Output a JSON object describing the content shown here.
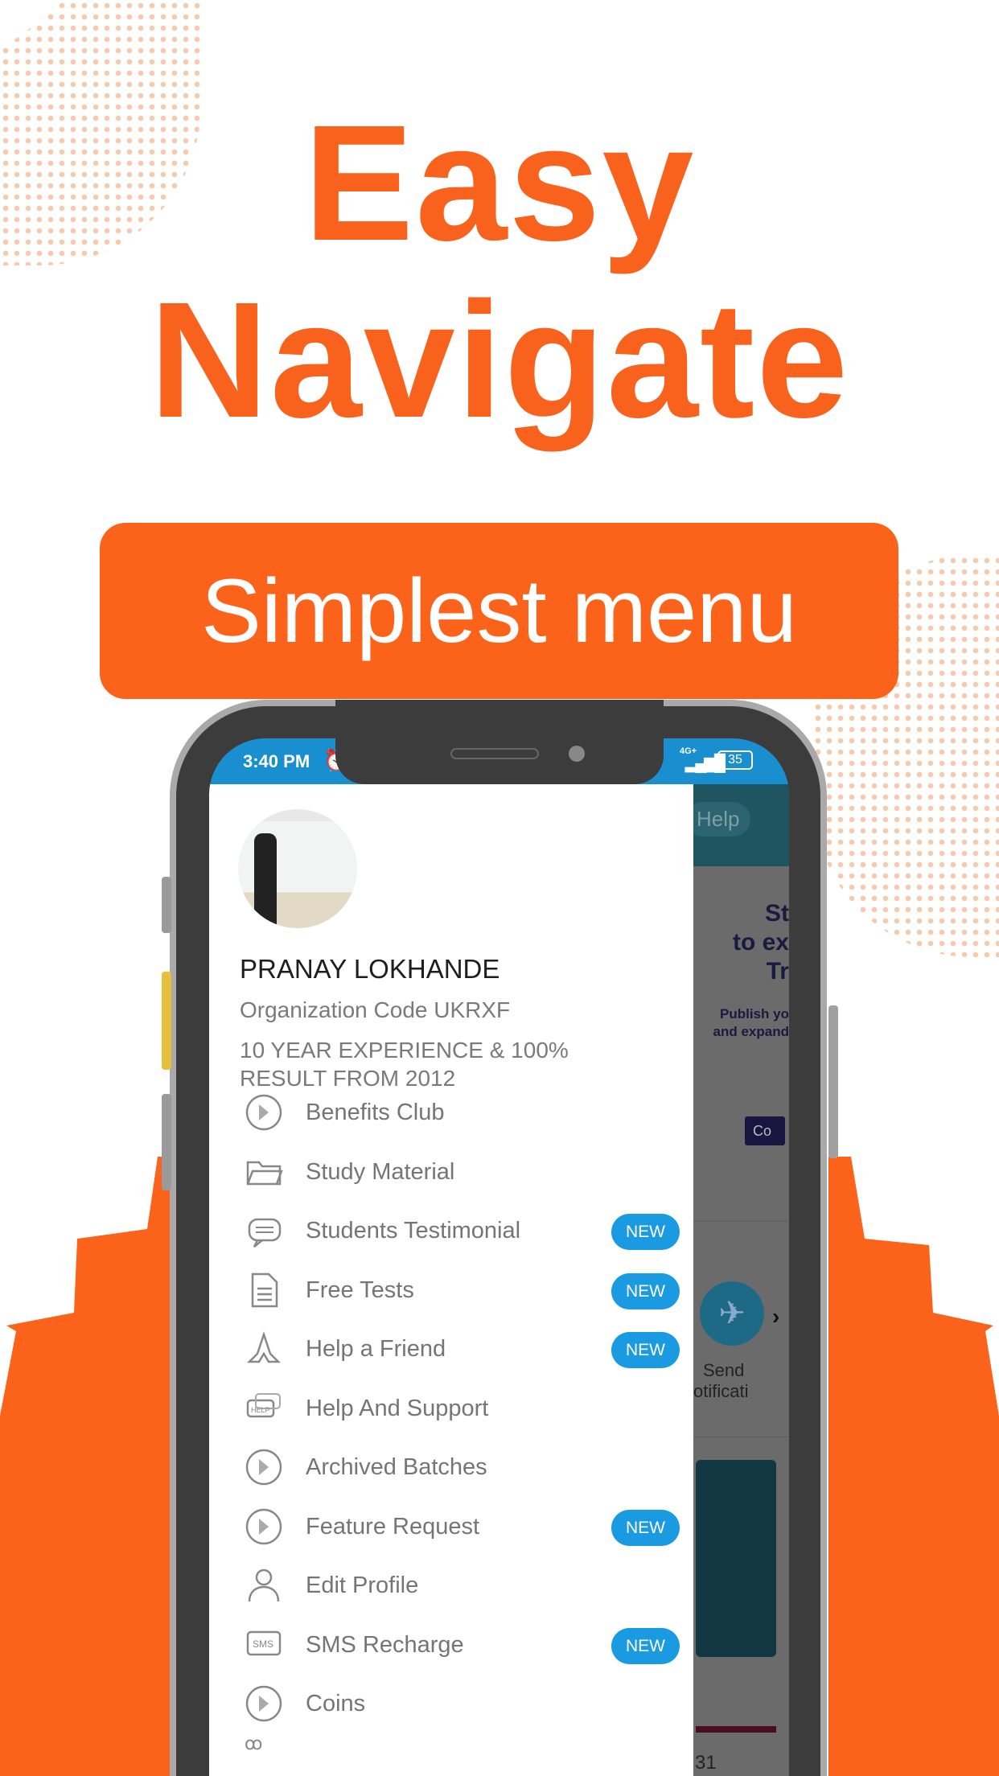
{
  "headline": {
    "line1": "Easy",
    "line2": "Navigate"
  },
  "banner": "Simplest menu",
  "colors": {
    "brand_orange": "#f9621d",
    "status_blue": "#1a8fd0",
    "badge_blue": "#1a9ae0"
  },
  "status_bar": {
    "time": "3:40 PM",
    "network": "4G+",
    "battery": "35"
  },
  "profile": {
    "name": "PRANAY LOKHANDE",
    "org_code": "Organization Code UKRXF",
    "description": "10 YEAR EXPERIENCE & 100% RESULT FROM 2012"
  },
  "menu": [
    {
      "label": "Benefits Club",
      "icon": "coin-icon",
      "badge": ""
    },
    {
      "label": "Study Material",
      "icon": "folder-icon",
      "badge": ""
    },
    {
      "label": "Students Testimonial",
      "icon": "quote-chat-icon",
      "badge": "NEW"
    },
    {
      "label": "Free Tests",
      "icon": "document-icon",
      "badge": "NEW"
    },
    {
      "label": "Help a Friend",
      "icon": "praying-hands-icon",
      "badge": "NEW"
    },
    {
      "label": "Help And Support",
      "icon": "help-chat-icon",
      "badge": ""
    },
    {
      "label": "Archived Batches",
      "icon": "coin-icon",
      "badge": ""
    },
    {
      "label": "Feature Request",
      "icon": "coin-icon",
      "badge": "NEW"
    },
    {
      "label": "Edit Profile",
      "icon": "user-icon",
      "badge": ""
    },
    {
      "label": "SMS Recharge",
      "icon": "sms-icon",
      "badge": "NEW"
    },
    {
      "label": "Coins",
      "icon": "coin-icon",
      "badge": ""
    }
  ],
  "background_app": {
    "help": "Help",
    "banner_lines": [
      "St",
      "to ex",
      "Tr"
    ],
    "sub_lines": [
      "Publish yo",
      "and expand"
    ],
    "button": "Co",
    "send_label": [
      "Send",
      "otificati"
    ],
    "partial_number": "31"
  }
}
